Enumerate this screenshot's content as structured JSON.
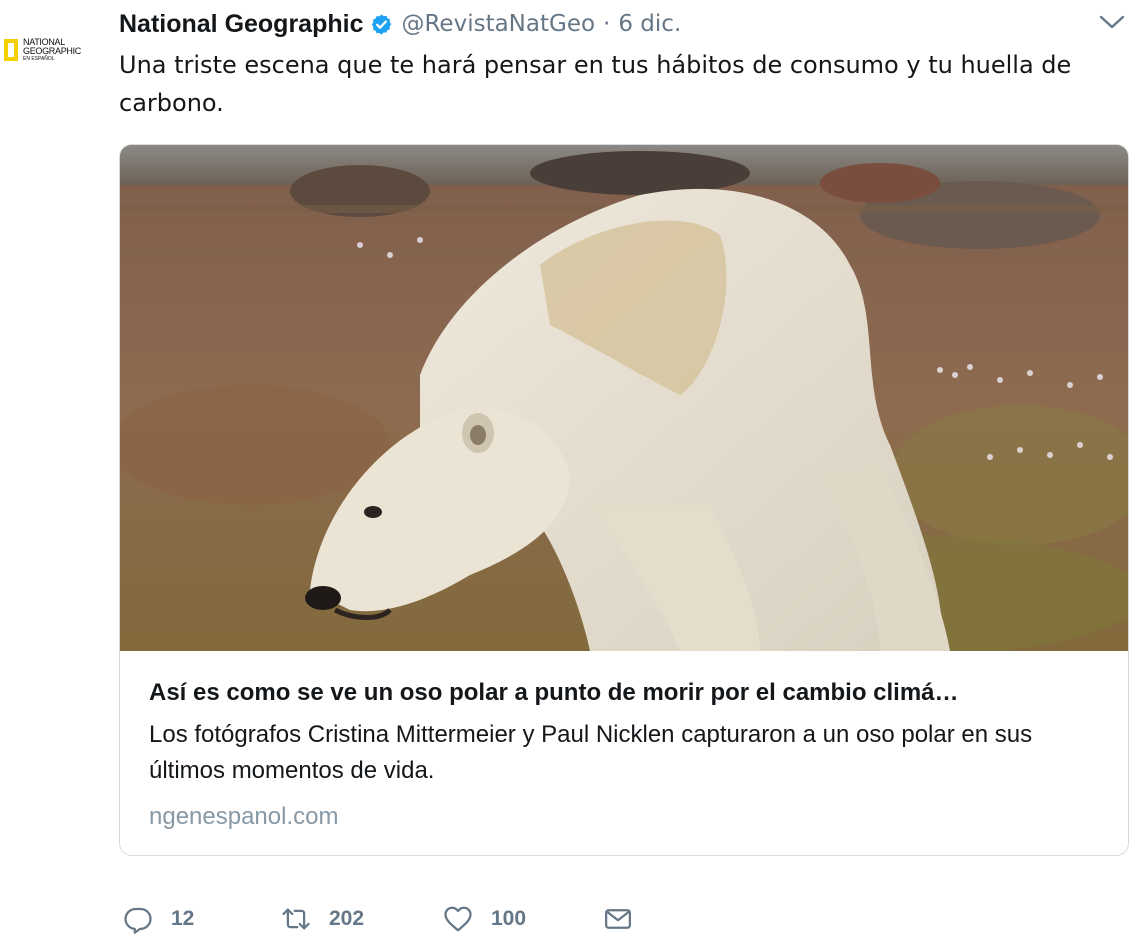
{
  "tweet": {
    "author": {
      "name": "National Geographic",
      "handle": "@RevistaNatGeo",
      "verified": true,
      "avatar_lines": [
        "NATIONAL",
        "GEOGRAPHIC",
        "EN ESPAÑOL"
      ]
    },
    "separator": "·",
    "date": "6 dic.",
    "text": "Una triste escena que te hará pensar en tus hábitos de consumo y tu huella de carbono.",
    "card": {
      "image_alt": "polar bear",
      "title": "Así es como se ve un oso polar a punto de morir por el cambio climá…",
      "description": "Los fotógrafos Cristina Mittermeier y Paul Nicklen capturaron a un oso polar en sus últimos momentos de vida.",
      "domain": "ngenespanol.com"
    },
    "actions": {
      "reply_count": "12",
      "retweet_count": "202",
      "like_count": "100"
    }
  },
  "icons": {
    "verified": "verified-badge-icon",
    "menu": "chevron-down-icon",
    "reply": "reply-icon",
    "retweet": "retweet-icon",
    "like": "heart-icon",
    "dm": "envelope-icon"
  },
  "colors": {
    "verified_blue": "#1da1f2",
    "muted": "#657786",
    "text": "#14171a",
    "ng_yellow": "#f5d000"
  }
}
